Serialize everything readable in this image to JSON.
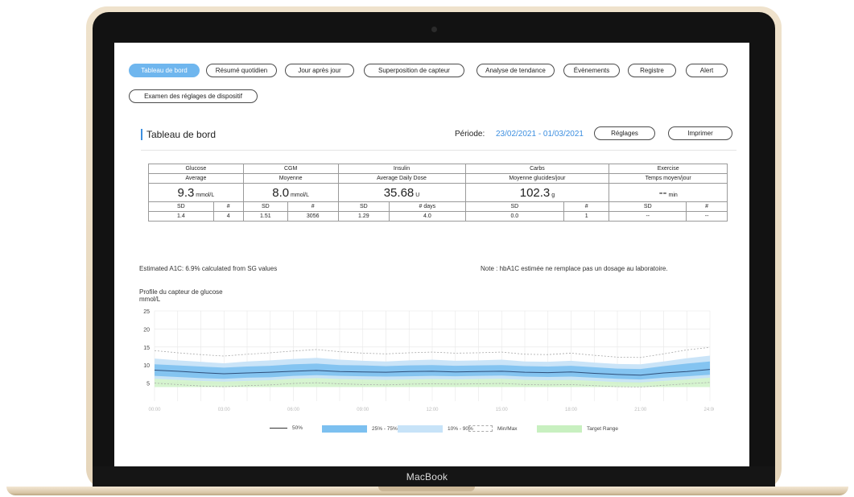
{
  "device": {
    "brand": "MacBook"
  },
  "tabs": [
    {
      "label": "Tableau de bord",
      "active": true
    },
    {
      "label": "Résumé quotidien",
      "active": false
    },
    {
      "label": "Jour après jour",
      "active": false
    },
    {
      "label": "Superposition de capteur",
      "active": false
    },
    {
      "label": "Analyse de tendance",
      "active": false
    },
    {
      "label": "Évènements",
      "active": false
    },
    {
      "label": "Registre",
      "active": false
    },
    {
      "label": "Alert",
      "active": false
    },
    {
      "label": "Examen des réglages de dispositif",
      "active": false
    }
  ],
  "header": {
    "title": "Tableau de bord",
    "period_label": "Période:",
    "period_value": "23/02/2021 - 01/03/2021",
    "settings_button": "Réglages",
    "print_button": "Imprimer"
  },
  "stats": [
    {
      "name": "Glucose",
      "metric": "Average",
      "value": "9.3",
      "unit": "mmol/L",
      "col1_label": "SD",
      "col2_label": "#",
      "col1_value": "1.4",
      "col2_value": "4"
    },
    {
      "name": "CGM",
      "metric": "Moyenne",
      "value": "8.0",
      "unit": "mmol/L",
      "col1_label": "SD",
      "col2_label": "#",
      "col1_value": "1.51",
      "col2_value": "3056"
    },
    {
      "name": "Insulin",
      "metric": "Average Daily Dose",
      "value": "35.68",
      "unit": "U",
      "col1_label": "SD",
      "col2_label": "# days",
      "col1_value": "1.29",
      "col2_value": "4.0"
    },
    {
      "name": "Carbs",
      "metric": "Moyenne glucides/jour",
      "value": "102.3",
      "unit": "g",
      "col1_label": "SD",
      "col2_label": "#",
      "col1_value": "0.0",
      "col2_value": "1"
    },
    {
      "name": "Exercise",
      "metric": "Temps moyen/jour",
      "value": "--",
      "unit": "min",
      "col1_label": "SD",
      "col2_label": "#",
      "col1_value": "--",
      "col2_value": "--"
    }
  ],
  "a1c_text": "Estimated A1C: 6.9%  calculated from SG values",
  "note_text": "Note : hbA1C estimée ne remplace pas un dosage au laboratoire.",
  "profile_title": "Profile du capteur de glucose",
  "profile_unit": "mmol/L",
  "legend": {
    "median": "50%",
    "iqr": "25% - 75%",
    "p10_90": "10% - 90%",
    "minmax": "Min/Max",
    "target": "Target Range"
  },
  "colors": {
    "accent": "#3d8fe0",
    "active_tab": "#6fb6ee",
    "iqr_band": "#7cc0f0",
    "p10_90_band": "#c7e3f8",
    "target_band": "#c8f0c0",
    "median_line": "#2f4f7a"
  },
  "chart_data": {
    "type": "area",
    "ylim": [
      0,
      25
    ],
    "yticks": [
      5,
      10,
      15,
      20,
      25
    ],
    "xticks": [
      "00:00",
      "03:00",
      "06:00",
      "09:00",
      "12:00",
      "15:00",
      "18:00",
      "21:00",
      "24:00"
    ],
    "target_range": [
      3.9,
      7.8
    ],
    "x_hours": [
      0,
      1,
      2,
      3,
      4,
      5,
      6,
      7,
      8,
      9,
      10,
      11,
      12,
      13,
      14,
      15,
      16,
      17,
      18,
      19,
      20,
      21,
      22,
      23,
      24
    ],
    "series": [
      {
        "name": "50%",
        "values": [
          8.6,
          8.3,
          7.9,
          7.6,
          7.8,
          8.0,
          8.3,
          8.5,
          8.2,
          8.1,
          8.0,
          8.2,
          8.3,
          8.1,
          8.2,
          8.3,
          8.0,
          7.9,
          8.1,
          7.7,
          7.4,
          7.2,
          7.8,
          8.2,
          8.8
        ]
      },
      {
        "name": "25% - 75%",
        "values_low": [
          7.0,
          6.7,
          6.4,
          6.2,
          6.5,
          6.6,
          7.0,
          7.2,
          7.0,
          6.9,
          6.8,
          6.9,
          7.0,
          6.9,
          7.0,
          7.1,
          6.8,
          6.7,
          6.8,
          6.5,
          6.2,
          6.0,
          6.5,
          6.9,
          7.3
        ],
        "values_high": [
          10.2,
          9.9,
          9.6,
          9.3,
          9.6,
          9.8,
          10.2,
          10.4,
          10.0,
          9.9,
          9.7,
          9.9,
          10.0,
          9.8,
          9.9,
          10.0,
          9.7,
          9.6,
          9.8,
          9.4,
          9.0,
          8.9,
          9.7,
          10.4,
          11.0
        ]
      },
      {
        "name": "10% - 90%",
        "values_low": [
          6.2,
          5.9,
          5.6,
          5.4,
          5.6,
          5.8,
          6.2,
          6.4,
          6.1,
          6.0,
          5.9,
          6.0,
          6.1,
          6.0,
          6.1,
          6.2,
          5.9,
          5.8,
          5.9,
          5.6,
          5.3,
          5.2,
          5.6,
          6.0,
          6.5
        ],
        "values_high": [
          11.8,
          11.3,
          10.9,
          10.5,
          11.0,
          11.3,
          11.7,
          12.0,
          11.5,
          11.2,
          11.0,
          11.3,
          11.5,
          11.2,
          11.3,
          11.5,
          11.0,
          10.9,
          11.2,
          10.7,
          10.3,
          10.2,
          11.0,
          11.9,
          12.6
        ]
      },
      {
        "name": "Min/Max",
        "values_low": [
          5.0,
          4.6,
          4.2,
          4.0,
          4.3,
          4.5,
          4.9,
          5.1,
          4.8,
          4.6,
          4.5,
          4.7,
          4.8,
          4.7,
          4.8,
          4.9,
          4.6,
          4.5,
          4.6,
          4.3,
          4.0,
          3.9,
          4.4,
          4.8,
          5.2
        ],
        "values_high": [
          14.0,
          13.4,
          12.9,
          12.5,
          13.0,
          13.4,
          13.9,
          14.3,
          13.7,
          13.3,
          13.1,
          13.4,
          13.6,
          13.3,
          13.4,
          13.6,
          13.0,
          12.9,
          13.3,
          12.7,
          12.2,
          12.1,
          13.1,
          14.2,
          14.9
        ]
      }
    ]
  }
}
